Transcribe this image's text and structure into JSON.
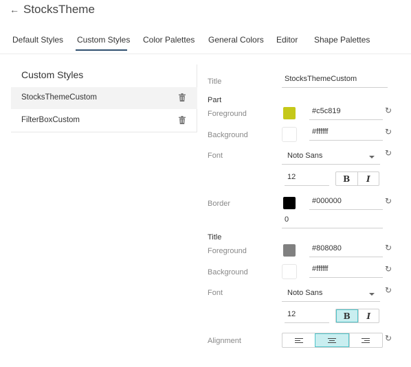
{
  "header": {
    "back_icon": "back-arrow-icon",
    "back_glyph": "←",
    "title": "StocksTheme"
  },
  "tabs": [
    {
      "label": "Default Styles"
    },
    {
      "label": "Custom Styles",
      "active": true
    },
    {
      "label": "Color Palettes"
    },
    {
      "label": "General Colors"
    },
    {
      "label": "Editor"
    },
    {
      "label": "Shape Palettes"
    }
  ],
  "left_panel": {
    "title": "Custom Styles",
    "items": [
      {
        "label": "StocksThemeCustom",
        "selected": true
      },
      {
        "label": "FilterBoxCustom"
      }
    ]
  },
  "form": {
    "title_label": "Title",
    "title_value": "StocksThemeCustom",
    "part": {
      "section": "Part",
      "foreground_label": "Foreground",
      "foreground_color": "#c5c819",
      "foreground_value": "#c5c819",
      "background_label": "Background",
      "background_color": "#ffffff",
      "background_value": "#ffffff",
      "font_label": "Font",
      "font_family": "Noto Sans",
      "font_size": "12",
      "bold_label": "B",
      "italic_label": "I",
      "bold_active": false,
      "border_label": "Border",
      "border_color": "#000000",
      "border_value": "#000000",
      "border_width": "0"
    },
    "title_section": {
      "section": "Title",
      "foreground_label": "Foreground",
      "foreground_color": "#808080",
      "foreground_value": "#808080",
      "background_label": "Background",
      "background_color": "#ffffff",
      "background_value": "#ffffff",
      "font_label": "Font",
      "font_family": "Noto Sans",
      "font_size": "12",
      "bold_label": "B",
      "italic_label": "I",
      "bold_active": true,
      "alignment_label": "Alignment",
      "alignment_selected": "center"
    },
    "reset_glyph": "↻"
  },
  "colors": {
    "accent": "#2f4f6f",
    "toggle_active_bg": "#c9eef0",
    "toggle_active_border": "#4fc3c9"
  }
}
